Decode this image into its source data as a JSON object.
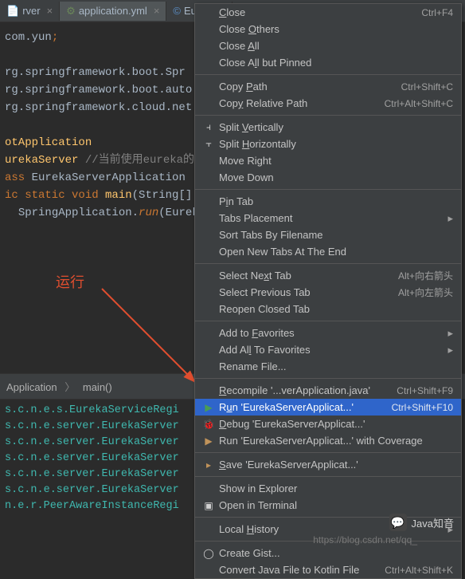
{
  "tabs": [
    {
      "label": "rver",
      "icon": "class-icon"
    },
    {
      "label": "application.yml",
      "icon": "yaml-icon"
    },
    {
      "label": "Eureka...",
      "icon": "class-icon"
    }
  ],
  "code": {
    "line1a": "com.yun",
    "line1b": ";",
    "line2a": "rg.springframework.boot.Spr",
    "line3a": "rg.springframework.boot.auto",
    "line4a": "rg.springframework.cloud.net",
    "line5": "otApplication",
    "line6a": "urekaServer ",
    "line6b": "//当前使用eureka的",
    "line7a": "ass ",
    "line7b": "EurekaServerApplication",
    "line8a": "ic static void ",
    "line8b": "main",
    "line8c": "(String[]",
    "line9a": "SpringApplication.",
    "line9b": "run",
    "line9c": "(Eureka"
  },
  "annotation": "运行",
  "breadcrumb": {
    "part1": "Application",
    "part2": "main()"
  },
  "console": [
    "s.c.n.e.s.EurekaServiceRegi",
    "s.c.n.e.server.EurekaServer",
    "s.c.n.e.server.EurekaServer",
    "s.c.n.e.server.EurekaServer",
    "s.c.n.e.server.EurekaServer",
    "s.c.n.e.server.EurekaServer",
    "n.e.r.PeerAwareInstanceRegi"
  ],
  "menu": [
    {
      "label_pre": "",
      "u": "C",
      "label_post": "lose",
      "shortcut": "Ctrl+F4"
    },
    {
      "label_pre": "Close ",
      "u": "O",
      "label_post": "thers"
    },
    {
      "label_pre": "Close ",
      "u": "A",
      "label_post": "ll"
    },
    {
      "label_pre": "Close A",
      "u": "l",
      "label_post": "l but Pinned"
    },
    "---",
    {
      "label_pre": "Copy ",
      "u": "P",
      "label_post": "ath",
      "shortcut": "Ctrl+Shift+C"
    },
    {
      "label_pre": "Cop",
      "u": "y",
      "label_post": " Relative Path",
      "shortcut": "Ctrl+Alt+Shift+C"
    },
    "---",
    {
      "icon": "split-v",
      "icon_glyph": "⫞",
      "label_pre": "Split ",
      "u": "V",
      "label_post": "ertically"
    },
    {
      "icon": "split-h",
      "icon_glyph": "⫟",
      "label_pre": "Split ",
      "u": "H",
      "label_post": "orizontally"
    },
    {
      "label": "Move Right"
    },
    {
      "label": "Move Down"
    },
    "---",
    {
      "label_pre": "P",
      "u": "i",
      "label_post": "n Tab"
    },
    {
      "label": "Tabs Placement",
      "sub": true
    },
    {
      "label": "Sort Tabs By Filename"
    },
    {
      "label": "Open New Tabs At The End"
    },
    "---",
    {
      "label_pre": "Select Ne",
      "u": "x",
      "label_post": "t Tab",
      "shortcut": "Alt+向右箭头"
    },
    {
      "label": "Select Previous Tab",
      "shortcut": "Alt+向左箭头"
    },
    {
      "label": "Reopen Closed Tab"
    },
    "---",
    {
      "label_pre": "Add to ",
      "u": "F",
      "label_post": "avorites",
      "sub": true
    },
    {
      "label_pre": "Add Al",
      "u": "l",
      "label_post": " To Favorites",
      "sub": true
    },
    {
      "label": "Rename File..."
    },
    "---",
    {
      "label_pre": "",
      "u": "R",
      "label_post": "ecompile '...verApplication.java'",
      "shortcut": "Ctrl+Shift+F9"
    },
    {
      "icon": "run",
      "icon_glyph": "▶",
      "highlighted": true,
      "label_pre": "R",
      "u": "u",
      "label_post": "n 'EurekaServerApplicat...'",
      "shortcut": "Ctrl+Shift+F10"
    },
    {
      "icon": "debug",
      "icon_glyph": "🐞",
      "label_pre": "",
      "u": "D",
      "label_post": "ebug 'EurekaServerApplicat...'"
    },
    {
      "icon": "coverage",
      "icon_glyph": "▶",
      "label": "Run 'EurekaServerApplicat...' with Coverage"
    },
    "---",
    {
      "icon": "save",
      "icon_glyph": "▸",
      "label_pre": "",
      "u": "S",
      "label_post": "ave 'EurekaServerApplicat...'"
    },
    "---",
    {
      "label": "Show in Explorer"
    },
    {
      "icon": "terminal",
      "icon_glyph": "▣",
      "label": "Open in Terminal"
    },
    "---",
    {
      "label_pre": "Local ",
      "u": "H",
      "label_post": "istory",
      "sub": true
    },
    "---",
    {
      "icon": "github",
      "icon_glyph": "◯",
      "label": "Create Gist..."
    },
    {
      "label": "Convert Java File to Kotlin File",
      "shortcut": "Ctrl+Alt+Shift+K"
    }
  ],
  "watermark": {
    "label": "Java知音",
    "url": "https://blog.csdn.net/qq_"
  }
}
